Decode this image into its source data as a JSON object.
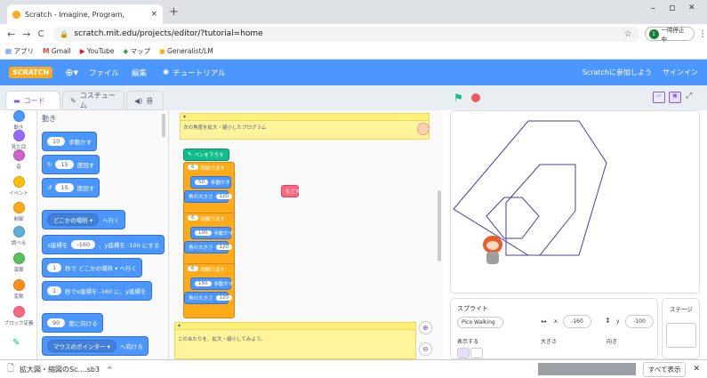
{
  "browser": {
    "tab_title": "Scratch - Imagine, Program,",
    "tab_close": "×",
    "new_tab": "+",
    "url": "scratch.mit.edu/projects/editor/?tutorial=home",
    "pause_label": "一時停止中",
    "pause_count": "1",
    "window_min": "–",
    "window_max": "▫",
    "window_close": "✕",
    "bookmarks": [
      "アプリ",
      "Gmail",
      "YouTube",
      "マップ",
      "Generalist/LM"
    ]
  },
  "menubar": {
    "logo": "SCRATCH",
    "file": "ファイル",
    "edit": "編集",
    "tutorial": "チュートリアル",
    "join": "Scratchに参加しよう",
    "signin": "サインイン"
  },
  "editor_tabs": {
    "code": "コード",
    "costumes": "コスチューム",
    "sounds": "音"
  },
  "categories": [
    {
      "label": "動き",
      "color": "#4c97ff"
    },
    {
      "label": "見た目",
      "color": "#9966ff"
    },
    {
      "label": "音",
      "color": "#cf63cf"
    },
    {
      "label": "イベント",
      "color": "#ffbf00"
    },
    {
      "label": "制御",
      "color": "#ffab19"
    },
    {
      "label": "調べる",
      "color": "#5cb1d6"
    },
    {
      "label": "演算",
      "color": "#59c059"
    },
    {
      "label": "変数",
      "color": "#ff8c1a"
    },
    {
      "label": "ブロック定義",
      "color": "#ff6680"
    }
  ],
  "palette": {
    "heading": "動き",
    "blocks": [
      {
        "pre": "",
        "val": "10",
        "post": "歩動かす"
      },
      {
        "pre": "↻",
        "val": "15",
        "post": "度回す"
      },
      {
        "pre": "↺",
        "val": "15",
        "post": "度回す"
      },
      {
        "pre": "",
        "val": "どこかの場所 ▾",
        "post": "へ行く"
      },
      {
        "pre": "x座標を",
        "val": "-160",
        "post": "、y座標を -100 にする"
      },
      {
        "pre": "",
        "val": "1",
        "post": "秒で どこかの場所 ▾ へ行く"
      },
      {
        "pre": "",
        "val": "1",
        "post": "秒でx座標を -160 に、y座標を"
      },
      {
        "pre": "",
        "val": "90",
        "post": "度に向ける"
      },
      {
        "pre": "",
        "val": "マウスのポインター ▾",
        "post": "へ向ける"
      }
    ]
  },
  "script": {
    "note_top": "次の角度を拡大・縮小したプログラム",
    "note_bottom": "このあたりを、拡大・縮小してみよう。",
    "pen_down": "ペンを下ろす",
    "repeat_label": "回繰り返す",
    "repeat_count": "6",
    "move_label": "歩動かす",
    "move_values": [
      "50",
      "100",
      "150"
    ],
    "turn_label": "角の大きさ",
    "turn_value": "120",
    "floating_block": "もどす"
  },
  "sprite": {
    "title": "スプライト",
    "name": "Pico Walking",
    "x_label": "x",
    "x_value": "-160",
    "y_label": "y",
    "y_value": "-100",
    "show_label": "表示する",
    "size_label": "大きさ",
    "direction_label": "向き"
  },
  "stage_panel": {
    "title": "ステージ"
  },
  "download": {
    "filename": "拡大図・縮図のSc....sb3",
    "show_all": "すべて表示",
    "close": "✕"
  },
  "colors": {
    "scratch_blue": "#4c97ff",
    "menu_purple": "#855cd6",
    "pen_line": "#4b3b9c"
  }
}
